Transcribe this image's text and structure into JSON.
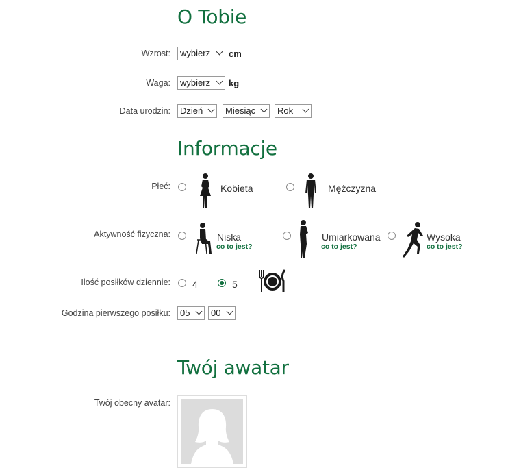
{
  "about": {
    "title": "O Tobie",
    "height_label": "Wzrost:",
    "height_value": "wybierz",
    "height_unit": "cm",
    "weight_label": "Waga:",
    "weight_value": "wybierz",
    "weight_unit": "kg",
    "birth_label": "Data urodzin:",
    "birth_day": "Dzień",
    "birth_month": "Miesiąc",
    "birth_year": "Rok"
  },
  "info": {
    "title": "Informacje",
    "sex_label": "Płeć:",
    "sex_female": "Kobieta",
    "sex_male": "Mężczyzna",
    "activity_label": "Aktywność fizyczna:",
    "activity_low": "Niska",
    "activity_medium": "Umiarkowana",
    "activity_high": "Wysoka",
    "help_text": "co to jest?",
    "meals_label": "Ilość posiłków dziennie:",
    "meals_4": "4",
    "meals_5": "5",
    "meals_selected": "5",
    "first_meal_label": "Godzina pierwszego posiłku:",
    "first_meal_hour": "05",
    "first_meal_minute": "00"
  },
  "avatar": {
    "title": "Twój awatar",
    "current_label": "Twój obecny avatar:"
  },
  "icons": {
    "female": "female-silhouette-icon",
    "male": "male-silhouette-icon",
    "low": "sitting-person-icon",
    "medium": "standing-person-icon",
    "high": "running-person-icon",
    "meals": "plate-fork-knife-icon",
    "avatar": "female-avatar-placeholder-icon"
  },
  "colors": {
    "accent": "#12703f"
  }
}
